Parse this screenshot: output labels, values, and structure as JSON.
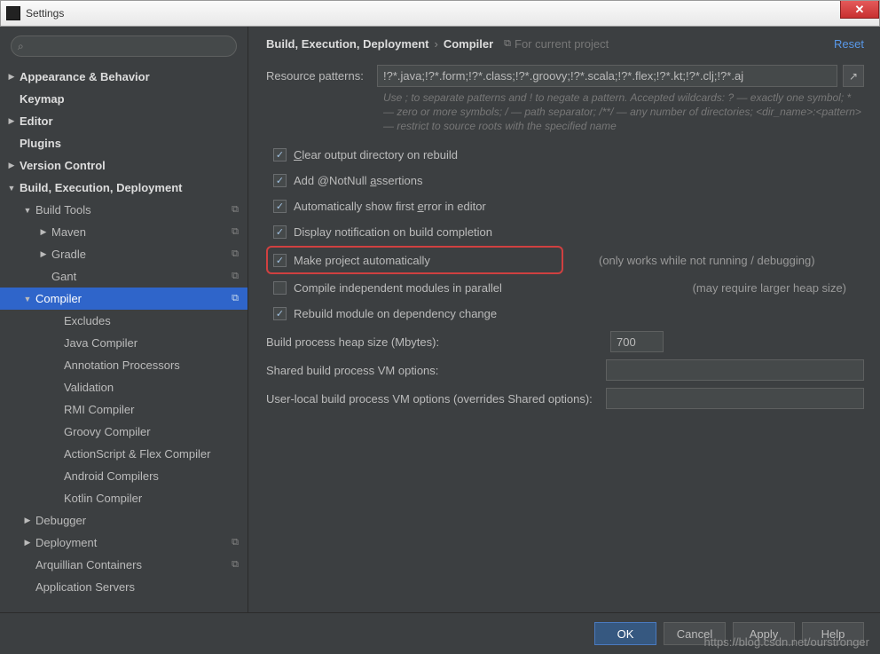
{
  "window": {
    "title": "Settings"
  },
  "search": {
    "placeholder": ""
  },
  "tree": {
    "appearance": "Appearance & Behavior",
    "keymap": "Keymap",
    "editor": "Editor",
    "plugins": "Plugins",
    "vcs": "Version Control",
    "bed": "Build, Execution, Deployment",
    "buildtools": "Build Tools",
    "maven": "Maven",
    "gradle": "Gradle",
    "gant": "Gant",
    "compiler": "Compiler",
    "excludes": "Excludes",
    "javacompiler": "Java Compiler",
    "annproc": "Annotation Processors",
    "validation": "Validation",
    "rmi": "RMI Compiler",
    "groovy": "Groovy Compiler",
    "asflex": "ActionScript & Flex Compiler",
    "android": "Android Compilers",
    "kotlin": "Kotlin Compiler",
    "debugger": "Debugger",
    "deployment": "Deployment",
    "arquillian": "Arquillian Containers",
    "appservers": "Application Servers"
  },
  "breadcrumb": {
    "root": "Build, Execution, Deployment",
    "current": "Compiler",
    "note": "For current project"
  },
  "reset": "Reset",
  "form": {
    "patterns_label": "Resource patterns:",
    "patterns_value": "!?*.java;!?*.form;!?*.class;!?*.groovy;!?*.scala;!?*.flex;!?*.kt;!?*.clj;!?*.aj",
    "hint": "Use ; to separate patterns and ! to negate a pattern. Accepted wildcards: ? — exactly one symbol; * — zero or more symbols; / — path separator; /**/ — any number of directories; <dir_name>:<pattern> — restrict to source roots with the specified name",
    "clear_output": "Clear output directory on rebuild",
    "add_notnull": "Add @NotNull assertions",
    "auto_error": "Automatically show first error in editor",
    "notify_build": "Display notification on build completion",
    "make_auto": "Make project automatically",
    "make_auto_note": "(only works while not running / debugging)",
    "compile_parallel": "Compile independent modules in parallel",
    "compile_parallel_note": "(may require larger heap size)",
    "rebuild_dep": "Rebuild module on dependency change",
    "heap_label": "Build process heap size (Mbytes):",
    "heap_value": "700",
    "shared_vm_label": "Shared build process VM options:",
    "shared_vm_value": "",
    "user_vm_label": "User-local build process VM options (overrides Shared options):",
    "user_vm_value": ""
  },
  "buttons": {
    "ok": "OK",
    "cancel": "Cancel",
    "apply": "Apply",
    "help": "Help"
  },
  "watermark": "https://blog.csdn.net/ourstronger"
}
